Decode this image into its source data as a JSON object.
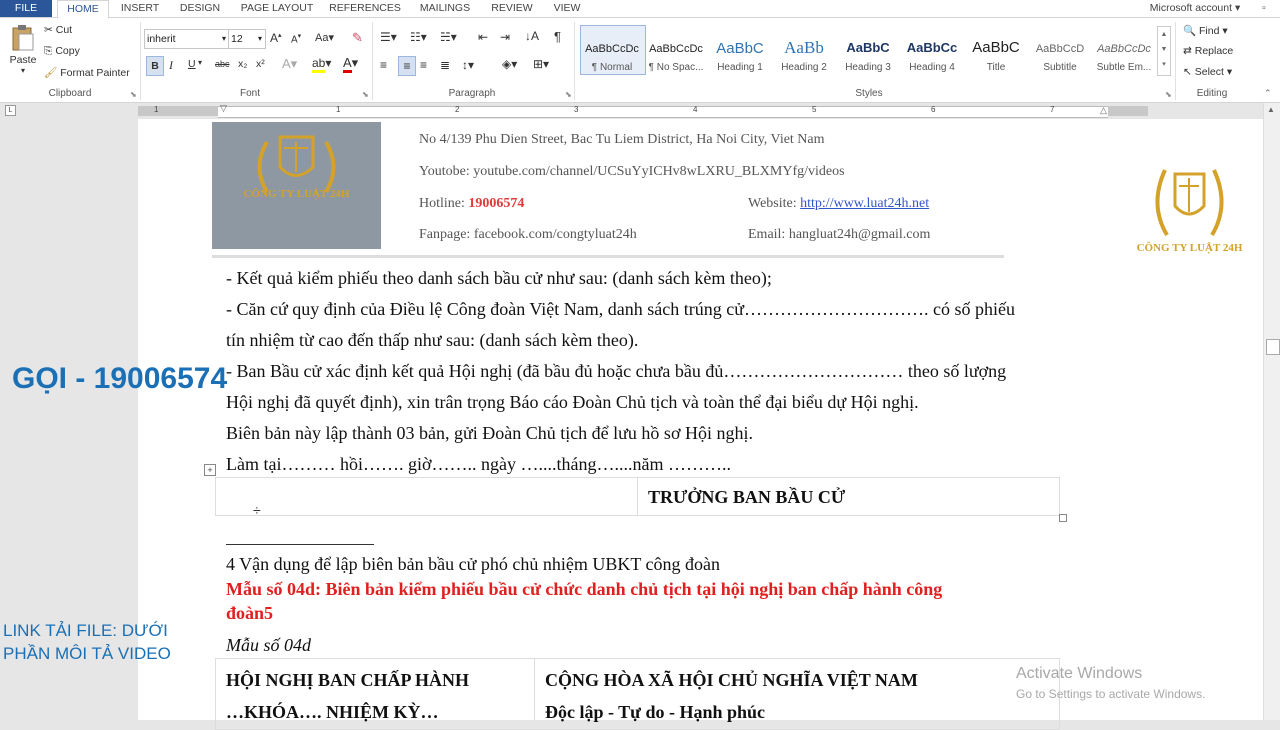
{
  "tabs": [
    "FILE",
    "HOME",
    "INSERT",
    "DESIGN",
    "PAGE LAYOUT",
    "REFERENCES",
    "MAILINGS",
    "REVIEW",
    "VIEW"
  ],
  "account": "Microsoft account",
  "clipboard": {
    "paste": "Paste",
    "cut": "Cut",
    "copy": "Copy",
    "format_painter": "Format Painter",
    "label": "Clipboard"
  },
  "font": {
    "name": "inherit",
    "size": "12",
    "label": "Font",
    "bold": "B",
    "italic": "I",
    "underline": "U",
    "strike": "abc",
    "sub": "x₂",
    "sup": "x²"
  },
  "paragraph": {
    "label": "Paragraph"
  },
  "styles": {
    "label": "Styles",
    "items": [
      {
        "preview": "AaBbCcDc",
        "name": "¶ Normal"
      },
      {
        "preview": "AaBbCcDc",
        "name": "¶ No Spac..."
      },
      {
        "preview": "AaBbC",
        "name": "Heading 1"
      },
      {
        "preview": "AaBb",
        "name": "Heading 2"
      },
      {
        "preview": "AaBbC",
        "name": "Heading 3"
      },
      {
        "preview": "AaBbCc",
        "name": "Heading 4"
      },
      {
        "preview": "AaBbC",
        "name": "Title"
      },
      {
        "preview": "AaBbCcD",
        "name": "Subtitle"
      },
      {
        "preview": "AaBbCcDc",
        "name": "Subtle Em..."
      }
    ]
  },
  "editing": {
    "find": "Find",
    "replace": "Replace",
    "select": "Select",
    "label": "Editing"
  },
  "letterhead": {
    "logo_text": "CÔNG TY LUẬT 24H",
    "address": "No  4/139 Phu  Dien  Street,  Bac  Tu  Liem  District,  Ha  Noi  City,  Viet  Nam",
    "youtube": "Youtobe: youtube.com/channel/UCSuYyICHv8wLXRU_BLXMYfg/videos",
    "hotline_label": "Hotline: ",
    "hotline": "19006574",
    "website_label": "Website: ",
    "website": "http://www.luat24h.net",
    "fanpage": "Fanpage: facebook.com/congtyluat24h",
    "email": "Email: hangluat24h@gmail.com"
  },
  "body": {
    "line1": "- Kết quả kiểm phiếu theo danh sách bầu cử như sau: (danh sách kèm theo);",
    "line2": "- Căn cứ quy định của Điều lệ Công đoàn Việt Nam, danh sách trúng cử…………………………. có số phiếu",
    "line3": "tín nhiệm từ cao đến thấp như sau: (danh sách kèm theo).",
    "line4": "- Ban Bầu cử xác định kết quả Hội nghị (đã bầu đủ hoặc chưa bầu đủ………………………… theo số lượng",
    "line5": "Hội nghị đã quyết định), xin trân trọng Báo cáo Đoàn Chủ tịch và toàn thể đại biểu dự Hội nghị.",
    "line6": "Biên bản này lập thành 03 bản, gửi Đoàn Chủ tịch để lưu hồ sơ Hội nghị.",
    "line7": "Làm tại……… hồi……. giờ…….. ngày …....tháng…....năm ………..",
    "sign": "TRƯỞNG BAN BẦU CỬ",
    "item4": "4 Vận dụng để lập biên bản bầu cử phó chủ nhiệm UBKT công đoàn",
    "title_red1": "Mẫu số 04d: Biên bản kiểm phiếu bầu cử chức danh chủ tịch tại hội nghị ban chấp hành công",
    "title_red2": "đoàn5",
    "mau": "Mẫu số 04d",
    "left_head1": "HỘI NGHỊ BAN CHẤP HÀNH",
    "left_head2": "…KHÓA…. NHIỆM KỲ…",
    "right_head1": "CỘNG HÒA XÃ HỘI CHỦ NGHĨA VIỆT NAM",
    "right_head2": "Độc lập - Tự do - Hạnh phúc"
  },
  "overlay": {
    "call": "GỌI - 19006574",
    "link1": "LINK TẢI FILE: DƯỚI",
    "link2": "PHẦN MÔI TẢ VIDEO",
    "activate1": "Activate Windows",
    "activate2": "Go to Settings to activate Windows.",
    "side_logo": "CÔNG TY LUẬT 24H"
  },
  "ruler_numbers": [
    "1",
    "1",
    "2",
    "3",
    "4",
    "5",
    "6",
    "7"
  ],
  "colors": {
    "file_tab": "#2b579a",
    "overlay_blue": "#1a6fb5",
    "red": "#e02020",
    "gold": "#d4a22a"
  }
}
